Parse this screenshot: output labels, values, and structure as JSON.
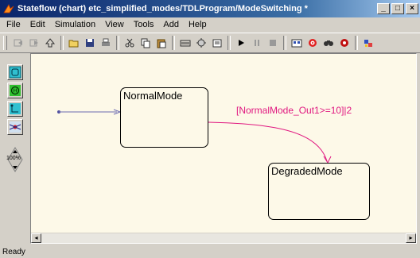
{
  "window": {
    "title": "Stateflow (chart) etc_simplified_modes/TDLProgram/ModeSwitching *",
    "minimize": "_",
    "maximize": "□",
    "close": "×"
  },
  "menubar": {
    "items": [
      "File",
      "Edit",
      "Simulation",
      "View",
      "Tools",
      "Add",
      "Help"
    ]
  },
  "toolbar": {
    "icons": [
      "back-icon",
      "forward-icon",
      "up-icon",
      "open-icon",
      "save-icon",
      "print-icon",
      "cut-icon",
      "copy-icon",
      "paste-icon",
      "model-explorer-icon",
      "debug-icon",
      "explorer-icon",
      "play-icon",
      "pause-icon",
      "stop-icon",
      "library-icon",
      "target-icon",
      "find-icon",
      "stop-record-icon",
      "build-icon"
    ]
  },
  "palette": {
    "zoom_label": "100%",
    "tools": [
      "state-tool",
      "history-junction-tool",
      "default-transition-tool",
      "connective-junction-tool",
      "zoom-tool"
    ]
  },
  "chart": {
    "states": [
      {
        "name": "NormalMode"
      },
      {
        "name": "DegradedMode"
      }
    ],
    "transition_label": "[NormalMode_Out1>=10]|2"
  },
  "statusbar": {
    "text": "Ready"
  },
  "colors": {
    "canvas": "#fdf9e8",
    "transition_label": "#e01880",
    "transition_line": "#e01880",
    "default_transition": "#5050a0"
  }
}
